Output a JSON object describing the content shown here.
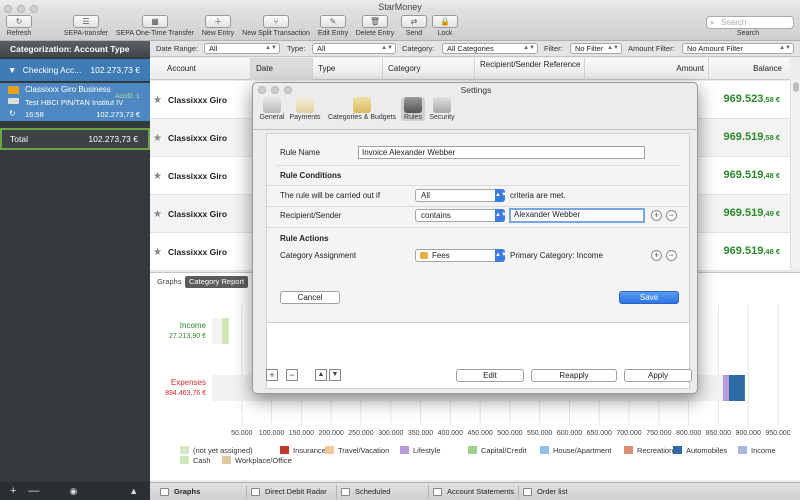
{
  "window": {
    "title": "StarMoney"
  },
  "toolbar": {
    "buttons": [
      {
        "label": "Refresh",
        "glyph": "↻"
      },
      {
        "label": "SEPA-transfer",
        "glyph": "☰"
      },
      {
        "label": "SEPA One-Time Transfer",
        "glyph": "▦"
      },
      {
        "label": "New Entry",
        "glyph": "＋"
      },
      {
        "label": "New Split Transaction",
        "glyph": "⑂"
      },
      {
        "label": "Edit Entry",
        "glyph": "✎"
      },
      {
        "label": "Delete Entry",
        "glyph": "🗑"
      },
      {
        "label": "Send",
        "glyph": "⇄"
      },
      {
        "label": "Lock",
        "glyph": "🔒"
      }
    ],
    "search_placeholder": "Search",
    "search_label": "Search"
  },
  "sidebar": {
    "header": "Categorization: Account Type",
    "group": {
      "label": "Checking Acc...",
      "amount": "102.273,73 €"
    },
    "account": {
      "name": "Classixxx Giro Business",
      "acc_id": "AccID: 1",
      "bank": "Test HBCI PIN/TAN Institut IV",
      "time": "16:58",
      "amount": "102.273,73 €"
    },
    "total": {
      "label": "Total",
      "amount": "102.273,73 €"
    },
    "bottom": {
      "add": "+",
      "remove": "—",
      "options": "◉",
      "eject": "▲"
    }
  },
  "filters": {
    "date_range_label": "Date Range:",
    "date_range_value": "All",
    "type_label": "Type:",
    "type_value": "All",
    "category_label": "Category:",
    "category_value": "All Categories",
    "filter_label": "Filter:",
    "filter_value": "No Filter",
    "amount_filter_label": "Amount Filter:",
    "amount_filter_value": "No Amount Filter"
  },
  "table": {
    "columns": [
      "Account",
      "Date",
      "Type",
      "Category",
      "Recipient/Sender Reference",
      "Amount",
      "Balance"
    ],
    "rows": [
      {
        "account": "Classixxx Giro",
        "balance_main": "969.523",
        "balance_dec": ",58 €"
      },
      {
        "account": "Classixxx Giro",
        "balance_main": "969.519",
        "balance_dec": ",58 €"
      },
      {
        "account": "Classixxx Giro",
        "balance_main": "969.519",
        "balance_dec": ",48 €"
      },
      {
        "account": "Classixxx Giro",
        "balance_main": "969.519",
        "balance_dec": ",49 €"
      },
      {
        "account": "Classixxx Giro",
        "balance_main": "969.519",
        "balance_dec": ",48 €"
      }
    ]
  },
  "chart_tabs": {
    "graphs": "Graphs",
    "category_report": "Category Report"
  },
  "chart_data": {
    "type": "bar",
    "orientation": "horizontal",
    "categories": [
      "Income",
      "Expenses"
    ],
    "category_values": [
      "27.213,90 €",
      "894.463,76 €"
    ],
    "values": [
      27213.9,
      894463.76
    ],
    "xlim": [
      0,
      950000
    ],
    "xticks": [
      "50.000",
      "100.000",
      "150.000",
      "200.000",
      "250.000",
      "300.000",
      "350.000",
      "400.000",
      "450.000",
      "500.000",
      "550.000",
      "600.000",
      "650.000",
      "700.000",
      "750.000",
      "800.000",
      "850.000",
      "900.000",
      "950.000"
    ],
    "legend": [
      {
        "name": "(not yet assigned)",
        "color": "#d7e8c8"
      },
      {
        "name": "Insurance",
        "color": "#c0392b"
      },
      {
        "name": "Travel/Vacation",
        "color": "#f3c89a"
      },
      {
        "name": "Lifestyle",
        "color": "#b79bd8"
      },
      {
        "name": "Capital/Credit",
        "color": "#9ed08a"
      },
      {
        "name": "House/Apartment",
        "color": "#8cc0e8"
      },
      {
        "name": "Recreation",
        "color": "#d98c6e"
      },
      {
        "name": "Automobiles",
        "color": "#2e6aa8"
      },
      {
        "name": "Income",
        "color": "#a8b8e0"
      },
      {
        "name": "Cash",
        "color": "#cfe6b8"
      },
      {
        "name": "Workplace/Office",
        "color": "#e0c8a0"
      }
    ]
  },
  "bottom_tabs": [
    "Graphs",
    "Direct Debit Radar",
    "Scheduled Transac...",
    "Account Statements",
    "Order list"
  ],
  "dialog": {
    "title": "Settings",
    "tabs": [
      "General",
      "Payments",
      "Categories & Budgets",
      "Rules",
      "Security"
    ],
    "rule_name_label": "Rule Name",
    "rule_name_value": "Invoice Alexander Webber",
    "conditions_heading": "Rule Conditions",
    "carried_out_label": "The rule will be carried out if",
    "carried_out_value": "All",
    "criteria_label": "criteria are met.",
    "recipient_label": "Recipient/Sender",
    "recipient_operator": "contains",
    "recipient_value": "Alexander Webber",
    "actions_heading": "Rule Actions",
    "category_assignment_label": "Category Assignment",
    "category_value": "Fees",
    "primary_category": "Primary Category: Income",
    "cancel": "Cancel",
    "save": "Save",
    "edit": "Edit",
    "reapply": "Reapply",
    "apply": "Apply",
    "plus": "+",
    "minus": "−",
    "up": "▲",
    "down": "▼"
  },
  "colors": {
    "accent": "#3b7ae0",
    "sidebar": "#34393d",
    "selected": "#3f7cb5",
    "balance": "#2a8a2a",
    "expenses": "#d62c2c",
    "income_label": "#2a8a2a"
  }
}
